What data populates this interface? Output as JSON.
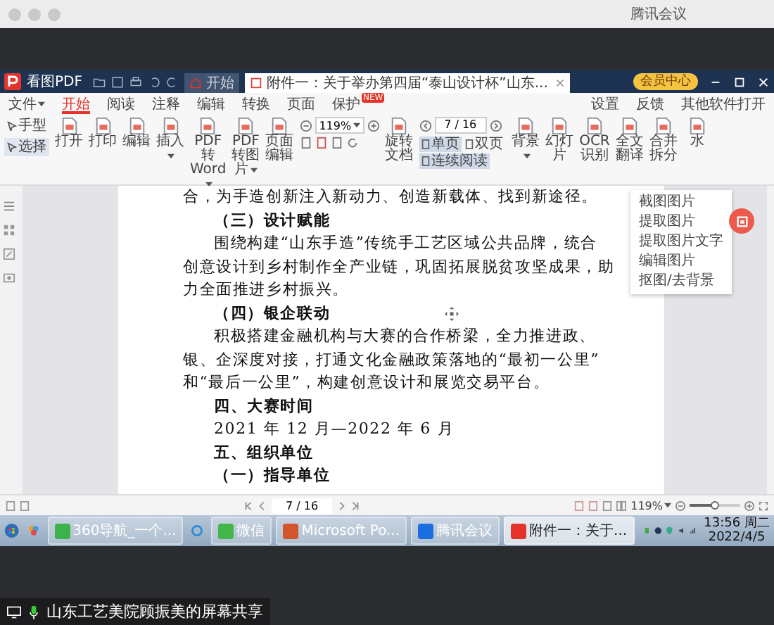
{
  "meeting": {
    "title": "腾讯会议",
    "share_label": "山东工艺美院顾振美的屏幕共享"
  },
  "pdf_app": {
    "app_name": "看图PDF",
    "tabs": [
      {
        "label": "开始",
        "selected": false
      },
      {
        "label": "附件一：关于举办第四届“泰山设计杯”山东...",
        "selected": true
      }
    ],
    "member_button": "会员中心",
    "menu": [
      {
        "label": "文件",
        "selected": false,
        "dropdown": true
      },
      {
        "label": "开始",
        "selected": true,
        "dropdown": false
      },
      {
        "label": "阅读",
        "selected": false,
        "dropdown": false
      },
      {
        "label": "注释",
        "selected": false,
        "dropdown": false
      },
      {
        "label": "编辑",
        "selected": false,
        "dropdown": false
      },
      {
        "label": "转换",
        "selected": false,
        "dropdown": false
      },
      {
        "label": "页面",
        "selected": false,
        "dropdown": false
      },
      {
        "label": "保护",
        "selected": false,
        "dropdown": false,
        "badge": "NEW"
      }
    ],
    "menu_right": [
      "设置",
      "反馈",
      "其他软件打开"
    ],
    "cursor_modes": [
      {
        "label": "手型",
        "selected": false
      },
      {
        "label": "选择",
        "selected": true
      }
    ],
    "tools_left": [
      {
        "label": "打开",
        "dropdown": false
      },
      {
        "label": "打印",
        "dropdown": false
      },
      {
        "label": "编辑",
        "dropdown": false
      },
      {
        "label": "插入",
        "dropdown": true
      },
      {
        "label": "PDF转Word",
        "dropdown": true
      },
      {
        "label": "PDF转图片",
        "dropdown": true
      },
      {
        "label": "页面编辑",
        "dropdown": false
      }
    ],
    "zoom_field": "119%",
    "tools_middle": [
      {
        "label": "旋转文档",
        "dropdown": false
      }
    ],
    "page_field": "7 / 16",
    "view_modes": [
      {
        "label": "单页",
        "selected": true
      },
      {
        "label": "双页",
        "selected": false
      },
      {
        "label": "连续阅读",
        "selected": true
      }
    ],
    "tools_right": [
      {
        "label": "背景",
        "dropdown": true
      },
      {
        "label": "幻灯片",
        "dropdown": false
      },
      {
        "label": "OCR识别",
        "dropdown": false
      },
      {
        "label": "全文翻译",
        "dropdown": false
      },
      {
        "label": "合并拆分",
        "dropdown": false
      },
      {
        "label": "水",
        "dropdown": false
      }
    ],
    "document": {
      "lines": [
        {
          "text": "合，为手造创新注入新动力、创造新载体、找到新途径。",
          "kind": "text",
          "indent": false
        },
        {
          "text": "（三）设计赋能",
          "kind": "heading",
          "indent": true
        },
        {
          "text": "围绕构建“山东手造”传统手工艺区域公共品牌，统合",
          "kind": "text",
          "indent": true
        },
        {
          "text": "创意设计到乡村制作全产业链，巩固拓展脱贫攻坚成果，助",
          "kind": "text",
          "indent": false
        },
        {
          "text": "力全面推进乡村振兴。",
          "kind": "text",
          "indent": false
        },
        {
          "text": "（四）银企联动",
          "kind": "heading",
          "indent": true
        },
        {
          "text": "积极搭建金融机构与大赛的合作桥梁，全力推进政、",
          "kind": "text",
          "indent": true
        },
        {
          "text": "银、企深度对接，打通文化金融政策落地的“最初一公里”",
          "kind": "text",
          "indent": false
        },
        {
          "text": "和“最后一公里”，构建创意设计和展览交易平台。",
          "kind": "text",
          "indent": false
        },
        {
          "text": "四、大赛时间",
          "kind": "heading",
          "indent": true
        },
        {
          "text": "2021 年 12 月—2022 年 6 月",
          "kind": "text",
          "indent": true
        },
        {
          "text": "五、组织单位",
          "kind": "heading",
          "indent": true
        },
        {
          "text": "（一）指导单位",
          "kind": "heading",
          "indent": true
        }
      ]
    },
    "image_menu": [
      "截图图片",
      "提取图片",
      "提取图片文字",
      "编辑图片",
      "抠图/去背景"
    ],
    "status_bar": {
      "page_field": "7 / 16",
      "zoom": "119%",
      "zoom_slider": {
        "level": 0.5
      }
    }
  },
  "taskbar": {
    "items": [
      {
        "label": "360导航_一个...",
        "selected": false
      },
      {
        "label": "微信",
        "selected": false
      },
      {
        "label": "Microsoft Po...",
        "selected": false
      },
      {
        "label": "腾讯会议",
        "selected": false
      },
      {
        "label": "附件一：关于...",
        "selected": true
      }
    ],
    "time": "13:56 周二",
    "date": "2022/4/5"
  }
}
